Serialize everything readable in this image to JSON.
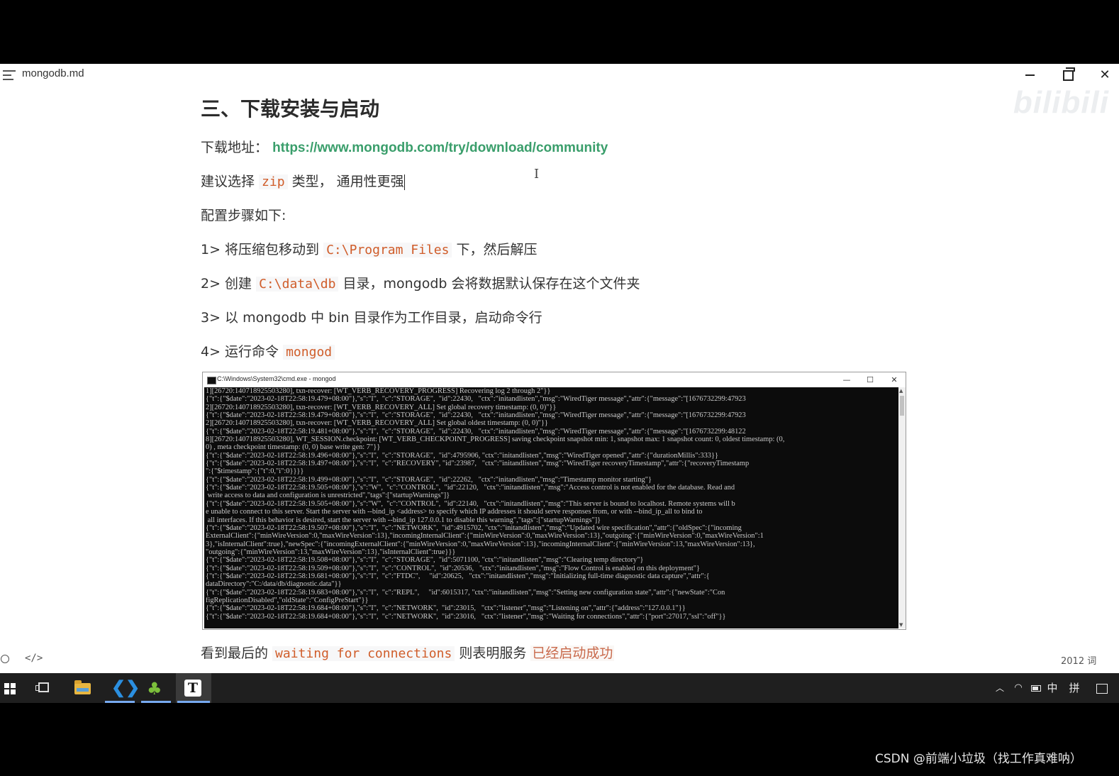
{
  "window": {
    "title": "mongodb.md",
    "watermark": "bilibili"
  },
  "doc": {
    "heading": "三、下载安装与启动",
    "download_label": "下载地址：",
    "download_url": "https://www.mongodb.com/try/download/community",
    "suggest_pre": "建议选择 ",
    "suggest_code": "zip",
    "suggest_post": " 类型， 通用性更强",
    "steps_title": "配置步骤如下:",
    "step1_pre": "1> 将压缩包移动到 ",
    "step1_code": "C:\\Program Files",
    "step1_post": " 下，然后解压",
    "step2_pre": "2> 创建 ",
    "step2_code": "C:\\data\\db",
    "step2_post": " 目录，mongodb 会将数据默认保存在这个文件夹",
    "step3": "3> 以 mongodb 中 bin 目录作为工作目录，启动命令行",
    "step4_pre": "4> 运行命令 ",
    "step4_code": "mongod",
    "final_pre": "看到最后的 ",
    "final_code": "waiting for connections",
    "final_mid": " 则表明服务 ",
    "final_hl": "已经启动成功"
  },
  "cmd": {
    "title": "C:\\Windows\\System32\\cmd.exe - mongod",
    "lines": [
      "1][26720:140718925503280], txn-recover: [WT_VERB_RECOVERY_PROGRESS] Recovering log 2 through 2\"}}",
      "{\"t\":{\"$date\":\"2023-02-18T22:58:19.479+08:00\"},\"s\":\"I\",  \"c\":\"STORAGE\",  \"id\":22430,   \"ctx\":\"initandlisten\",\"msg\":\"WiredTiger message\",\"attr\":{\"message\":\"[1676732299:47923",
      "2][26720:140718925503280], txn-recover: [WT_VERB_RECOVERY_ALL] Set global recovery timestamp: (0, 0)\"}}",
      "{\"t\":{\"$date\":\"2023-02-18T22:58:19.479+08:00\"},\"s\":\"I\",  \"c\":\"STORAGE\",  \"id\":22430,   \"ctx\":\"initandlisten\",\"msg\":\"WiredTiger message\",\"attr\":{\"message\":\"[1676732299:47923",
      "2][26720:140718925503280], txn-recover: [WT_VERB_RECOVERY_ALL] Set global oldest timestamp: (0, 0)\"}}",
      "{\"t\":{\"$date\":\"2023-02-18T22:58:19.481+08:00\"},\"s\":\"I\",  \"c\":\"STORAGE\",  \"id\":22430,   \"ctx\":\"initandlisten\",\"msg\":\"WiredTiger message\",\"attr\":{\"message\":\"[1676732299:48122",
      "8][26720:140718925503280], WT_SESSION.checkpoint: [WT_VERB_CHECKPOINT_PROGRESS] saving checkpoint snapshot min: 1, snapshot max: 1 snapshot count: 0, oldest timestamp: (0,",
      "0) , meta checkpoint timestamp: (0, 0) base write gen: 7\"}}",
      "{\"t\":{\"$date\":\"2023-02-18T22:58:19.496+08:00\"},\"s\":\"I\",  \"c\":\"STORAGE\",  \"id\":4795906, \"ctx\":\"initandlisten\",\"msg\":\"WiredTiger opened\",\"attr\":{\"durationMillis\":333}}",
      "{\"t\":{\"$date\":\"2023-02-18T22:58:19.497+08:00\"},\"s\":\"I\",  \"c\":\"RECOVERY\", \"id\":23987,   \"ctx\":\"initandlisten\",\"msg\":\"WiredTiger recoveryTimestamp\",\"attr\":{\"recoveryTimestamp",
      "\":{\"$timestamp\":{\"t\":0,\"i\":0}}}}",
      "{\"t\":{\"$date\":\"2023-02-18T22:58:19.499+08:00\"},\"s\":\"I\",  \"c\":\"STORAGE\",  \"id\":22262,   \"ctx\":\"initandlisten\",\"msg\":\"Timestamp monitor starting\"}",
      "{\"t\":{\"$date\":\"2023-02-18T22:58:19.505+08:00\"},\"s\":\"W\",  \"c\":\"CONTROL\",  \"id\":22120,   \"ctx\":\"initandlisten\",\"msg\":\"Access control is not enabled for the database. Read and",
      " write access to data and configuration is unrestricted\",\"tags\":[\"startupWarnings\"]}",
      "{\"t\":{\"$date\":\"2023-02-18T22:58:19.505+08:00\"},\"s\":\"W\",  \"c\":\"CONTROL\",  \"id\":22140,   \"ctx\":\"initandlisten\",\"msg\":\"This server is bound to localhost. Remote systems will b",
      "e unable to connect to this server. Start the server with --bind_ip <address> to specify which IP addresses it should serve responses from, or with --bind_ip_all to bind to",
      " all interfaces. If this behavior is desired, start the server with --bind_ip 127.0.0.1 to disable this warning\",\"tags\":[\"startupWarnings\"]}",
      "{\"t\":{\"$date\":\"2023-02-18T22:58:19.507+08:00\"},\"s\":\"I\",  \"c\":\"NETWORK\",  \"id\":4915702, \"ctx\":\"initandlisten\",\"msg\":\"Updated wire specification\",\"attr\":{\"oldSpec\":{\"incoming",
      "ExternalClient\":{\"minWireVersion\":0,\"maxWireVersion\":13},\"incomingInternalClient\":{\"minWireVersion\":0,\"maxWireVersion\":13},\"outgoing\":{\"minWireVersion\":0,\"maxWireVersion\":1",
      "3},\"isInternalClient\":true},\"newSpec\":{\"incomingExternalClient\":{\"minWireVersion\":0,\"maxWireVersion\":13},\"incomingInternalClient\":{\"minWireVersion\":13,\"maxWireVersion\":13},",
      "\"outgoing\":{\"minWireVersion\":13,\"maxWireVersion\":13},\"isInternalClient\":true}}}",
      "{\"t\":{\"$date\":\"2023-02-18T22:58:19.508+08:00\"},\"s\":\"I\",  \"c\":\"STORAGE\",  \"id\":5071100, \"ctx\":\"initandlisten\",\"msg\":\"Clearing temp directory\"}",
      "{\"t\":{\"$date\":\"2023-02-18T22:58:19.509+08:00\"},\"s\":\"I\",  \"c\":\"CONTROL\",  \"id\":20536,   \"ctx\":\"initandlisten\",\"msg\":\"Flow Control is enabled on this deployment\"}",
      "{\"t\":{\"$date\":\"2023-02-18T22:58:19.681+08:00\"},\"s\":\"I\",  \"c\":\"FTDC\",     \"id\":20625,   \"ctx\":\"initandlisten\",\"msg\":\"Initializing full-time diagnostic data capture\",\"attr\":{",
      "dataDirectory\":\"C:/data/db/diagnostic.data\"}}",
      "{\"t\":{\"$date\":\"2023-02-18T22:58:19.683+08:00\"},\"s\":\"I\",  \"c\":\"REPL\",     \"id\":6015317, \"ctx\":\"initandlisten\",\"msg\":\"Setting new configuration state\",\"attr\":{\"newState\":\"Con",
      "figReplicationDisabled\",\"oldState\":\"ConfigPreStart\"}}",
      "{\"t\":{\"$date\":\"2023-02-18T22:58:19.684+08:00\"},\"s\":\"I\",  \"c\":\"NETWORK\",  \"id\":23015,   \"ctx\":\"listener\",\"msg\":\"Listening on\",\"attr\":{\"address\":\"127.0.0.1\"}}",
      "{\"t\":{\"$date\":\"2023-02-18T22:58:19.684+08:00\"},\"s\":\"I\",  \"c\":\"NETWORK\",  \"id\":23016,   \"ctx\":\"listener\",\"msg\":\"Waiting for connections\",\"attr\":{\"port\":27017,\"ssl\":\"off\"}}"
    ]
  },
  "status": {
    "word_count": "2012 词",
    "source_toggle": "</>"
  },
  "taskbar": {
    "ime": "中",
    "ime2": "拼"
  },
  "overlay": {
    "csdn": "CSDN @前端小垃圾（找工作真难呐）"
  },
  "colors": {
    "link": "#3a9e6b",
    "code": "#d05d2a",
    "terminal_bg": "#0c0c0c",
    "taskbar_bg": "#1f1f1f"
  }
}
